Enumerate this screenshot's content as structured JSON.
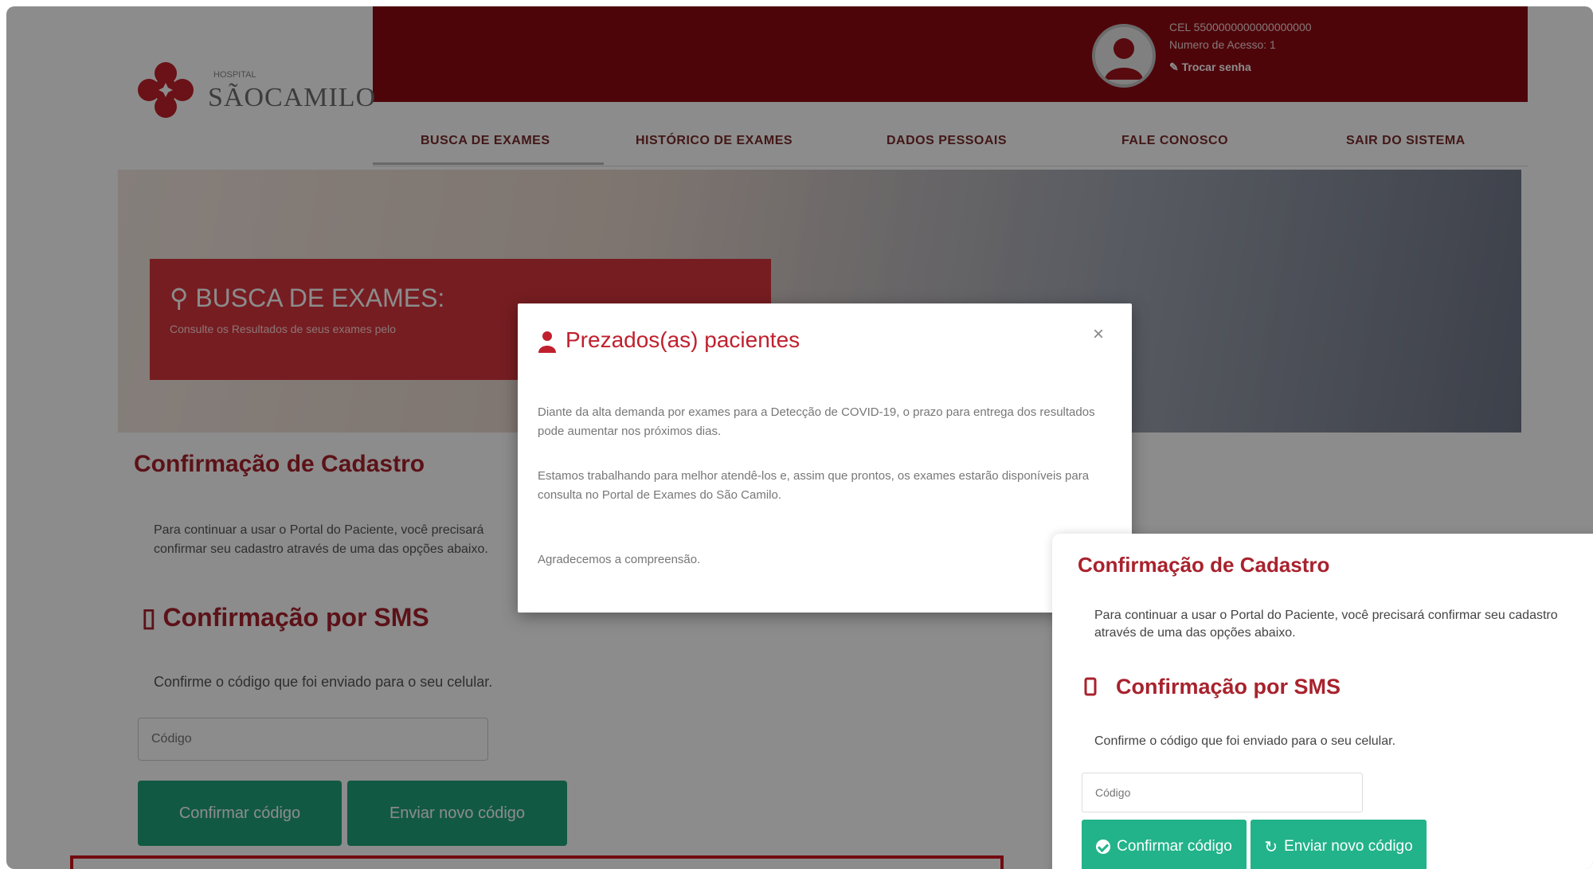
{
  "brand": {
    "name": "SÃOCAMILO",
    "small": "HOSPITAL"
  },
  "user": {
    "line1": "CEL 5500000000000000000",
    "line2": "Numero de Acesso: 1",
    "change_password": "✎ Trocar senha"
  },
  "nav": [
    {
      "label": "BUSCA DE EXAMES"
    },
    {
      "label": "HISTÓRICO DE EXAMES"
    },
    {
      "label": "DADOS PESSOAIS"
    },
    {
      "label": "FALE CONOSCO"
    },
    {
      "label": "SAIR DO SISTEMA"
    }
  ],
  "banner": {
    "title": "BUSCA DE EXAMES:",
    "subtitle": "Consulte os Resultados de seus exames pelo"
  },
  "page": {
    "heading": "Confirmação de Cadastro",
    "text": "Para continuar a usar o Portal do Paciente, você precisará confirmar seu cadastro através de uma das opções abaixo.",
    "sms_heading": "Confirmação por SMS",
    "sms_text": "Confirme o código que foi enviado para o seu celular.",
    "code_placeholder": "Código",
    "confirm_label": "Confirmar código",
    "send_label": "Enviar novo código"
  },
  "modal": {
    "title": "Prezados(as) pacientes",
    "close": "×",
    "p1": "Diante da alta demanda por exames para a Detecção de COVID-19, o prazo para entrega dos resultados pode aumentar nos próximos dias.",
    "p2": "Estamos trabalhando para melhor atendê-los e, assim que prontos, os exames estarão disponíveis para consulta no Portal de Exames do São Camilo.",
    "p3": "Agradecemos a compreensão."
  },
  "zoom": {
    "heading": "Confirmação de Cadastro",
    "text": "Para continuar a usar o Portal do Paciente, você precisará confirmar seu cadastro através de uma das opções abaixo.",
    "sms_heading": "Confirmação por SMS",
    "sms_text": "Confirme o código que foi enviado para o seu celular.",
    "code_placeholder": "Código",
    "confirm_label": "Confirmar código",
    "send_label": "Enviar novo código"
  },
  "colors": {
    "brand_red": "#8e0a13",
    "heading_red": "#a8222d",
    "button_green": "#22b38a",
    "highlight_red": "#d0141e"
  }
}
